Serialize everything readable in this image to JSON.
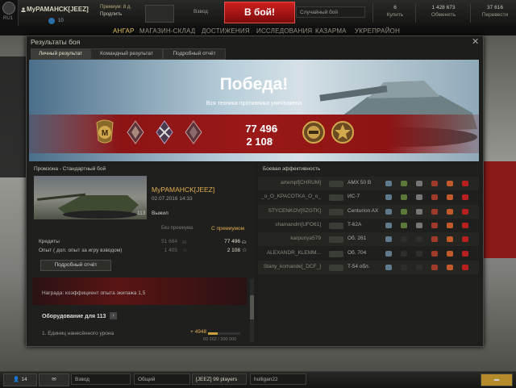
{
  "topbar": {
    "region": "RU1",
    "player_name": "MyPAMAHCK[JEEZ]",
    "xp_count": "10",
    "premium_line1": "Премиум: 8 д.",
    "premium_line2": "Продлить",
    "platoon": "Взвод",
    "battle_button": "В бой!",
    "battle_mode": "Случайный бой",
    "gold": "6",
    "gold_action": "Купить",
    "credits": "1 428 673",
    "credits_action": "Обменять",
    "free_xp": "37 616",
    "free_xp_action": "Перевести"
  },
  "nav": [
    "АНГАР",
    "МАГАЗИН-СКЛАД",
    "ДОСТИЖЕНИЯ",
    "ИССЛЕДОВАНИЯ",
    "КАЗАРМА",
    "УКРЕПРАЙОН"
  ],
  "dialog": {
    "title": "Результаты боя",
    "tabs": [
      "Личный результат",
      "Командный результат",
      "Подробный отчёт"
    ],
    "banner": {
      "result": "Победа!",
      "subtitle": "Вся техника противника уничтожена",
      "credits_total": "77 496",
      "exp_total": "2 108"
    },
    "left": {
      "battle_info": "Промзона - Стандартный бой",
      "player": "MyPAMAHCK[JEEZ]",
      "date": "02.07.2016 14:33",
      "vehicle": "113",
      "status": "Выжил",
      "hdr_base": "Без премиума",
      "hdr_prem": "С премиумом",
      "rows": [
        {
          "label": "Кредиты",
          "base": "51 664",
          "prem": "77 496"
        },
        {
          "label": "Опыт ( доп. опыт за игру взводом)",
          "base": "1 405",
          "prem": "2 108"
        }
      ],
      "report_button": "Подробный отчёт",
      "reward": "Награда:   коэффициент опыта экипажа 1,5",
      "equipment_title": "Оборудование для 113",
      "damage_label": "1. Единиц нанесённого урона",
      "damage_plus": "+ 4948",
      "damage_progress": "60 262 / 200 000",
      "damage_fraction": 0.3
    },
    "right": {
      "title": "Боевая эффективность",
      "players": [
        {
          "name": "artempf[CHRUM]",
          "tank": "AMX 50 B"
        },
        {
          "name": "_o_O_KPACOTKA_O_o_",
          "tank": "ИС-7"
        },
        {
          "name": "STYCENKOV[SZGTK]",
          "tank": "Centurion AX"
        },
        {
          "name": "shamandm[UFO61]",
          "tank": "T-62A"
        },
        {
          "name": "karpunya579",
          "tank": "Об. 261"
        },
        {
          "name": "ALEXANDR_KLEMM...",
          "tank": "Об. 704"
        },
        {
          "name": "Stany_komande[_DCF_]",
          "tank": "T-54 обл."
        }
      ]
    }
  },
  "bottombar": {
    "friends": "14",
    "platoon": "Взвод",
    "channels": [
      "Общий",
      "[JEEZ] 99 players",
      "hulligan22"
    ]
  }
}
